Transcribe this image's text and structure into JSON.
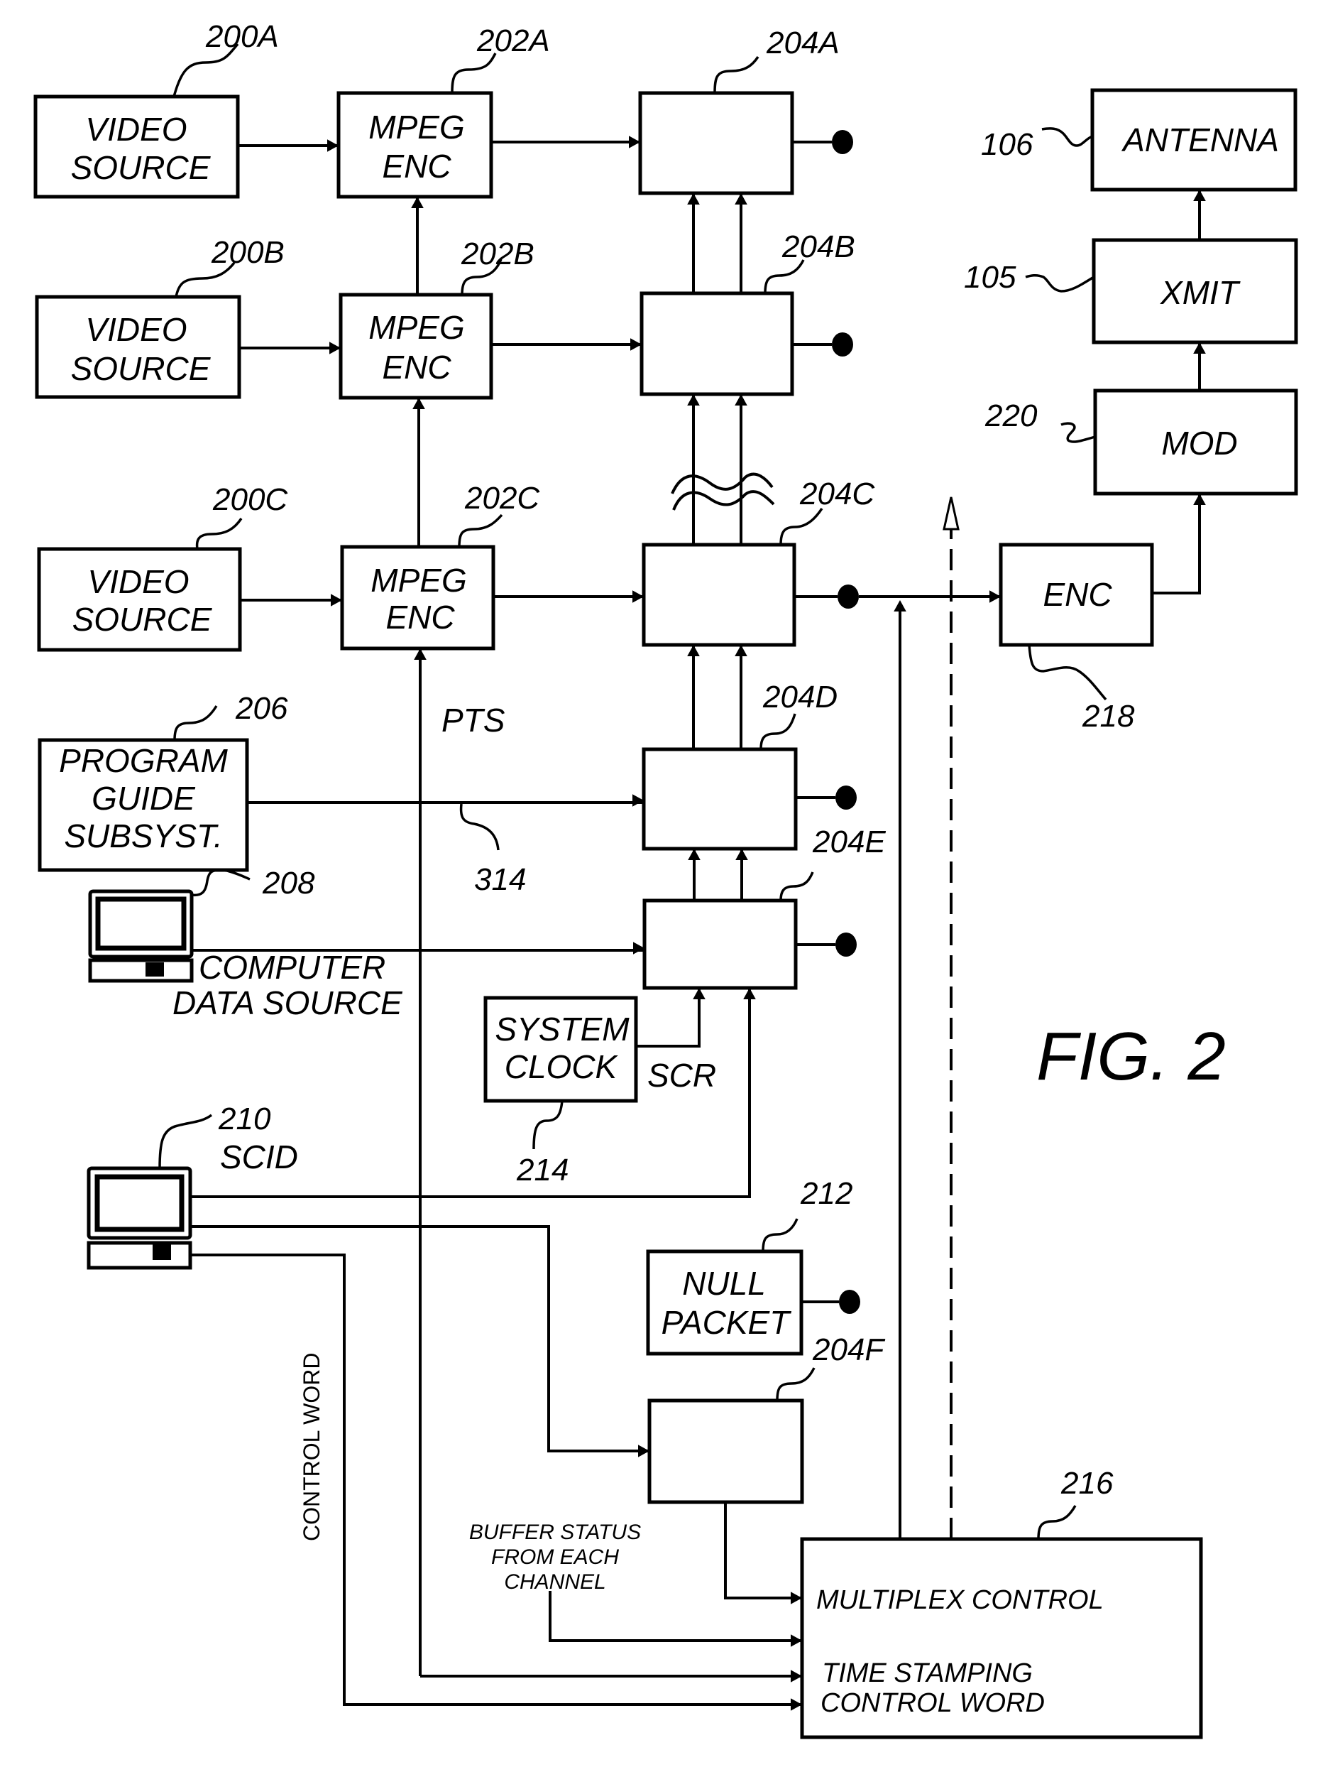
{
  "figure": {
    "title": "FIG. 2",
    "colors": {
      "ink": "#000000",
      "paper": "#ffffff"
    }
  },
  "blocks": {
    "video_source_a": {
      "ref": "200A",
      "lines": [
        "VIDEO",
        "SOURCE"
      ]
    },
    "video_source_b": {
      "ref": "200B",
      "lines": [
        "VIDEO",
        "SOURCE"
      ]
    },
    "video_source_c": {
      "ref": "200C",
      "lines": [
        "VIDEO",
        "SOURCE"
      ]
    },
    "mpeg_enc_a": {
      "ref": "202A",
      "lines": [
        "MPEG",
        "ENC"
      ]
    },
    "mpeg_enc_b": {
      "ref": "202B",
      "lines": [
        "MPEG",
        "ENC"
      ]
    },
    "mpeg_enc_c": {
      "ref": "202C",
      "lines": [
        "MPEG",
        "ENC"
      ]
    },
    "packetizer_a": {
      "ref": "204A"
    },
    "packetizer_b": {
      "ref": "204B"
    },
    "packetizer_c": {
      "ref": "204C"
    },
    "packetizer_d": {
      "ref": "204D"
    },
    "packetizer_e": {
      "ref": "204E"
    },
    "packetizer_f": {
      "ref": "204F"
    },
    "program_guide": {
      "ref": "206",
      "lines": [
        "PROGRAM",
        "GUIDE",
        "SUBSYST."
      ]
    },
    "computer_data_source": {
      "ref": "208",
      "lines": [
        "COMPUTER",
        "DATA SOURCE"
      ]
    },
    "scid_computer": {
      "ref": "210",
      "label": "SCID"
    },
    "null_packet": {
      "ref": "212",
      "lines": [
        "NULL",
        "PACKET"
      ]
    },
    "system_clock": {
      "ref": "214",
      "lines": [
        "SYSTEM",
        "CLOCK"
      ]
    },
    "multiplex_control": {
      "ref": "216",
      "lines": [
        "MULTIPLEX CONTROL",
        "TIME STAMPING",
        "CONTROL WORD"
      ]
    },
    "encoder": {
      "ref": "218",
      "label": "ENC"
    },
    "modulator": {
      "ref": "220",
      "label": "MOD"
    },
    "transmitter": {
      "ref": "105",
      "label": "XMIT"
    },
    "antenna": {
      "ref": "106",
      "label": "ANTENNA"
    }
  },
  "signals": {
    "pts": "PTS",
    "scr": "SCR",
    "line_314": "314",
    "control_word": "CONTROL WORD",
    "buffer_status": [
      "BUFFER STATUS",
      "FROM EACH",
      "CHANNEL"
    ]
  }
}
